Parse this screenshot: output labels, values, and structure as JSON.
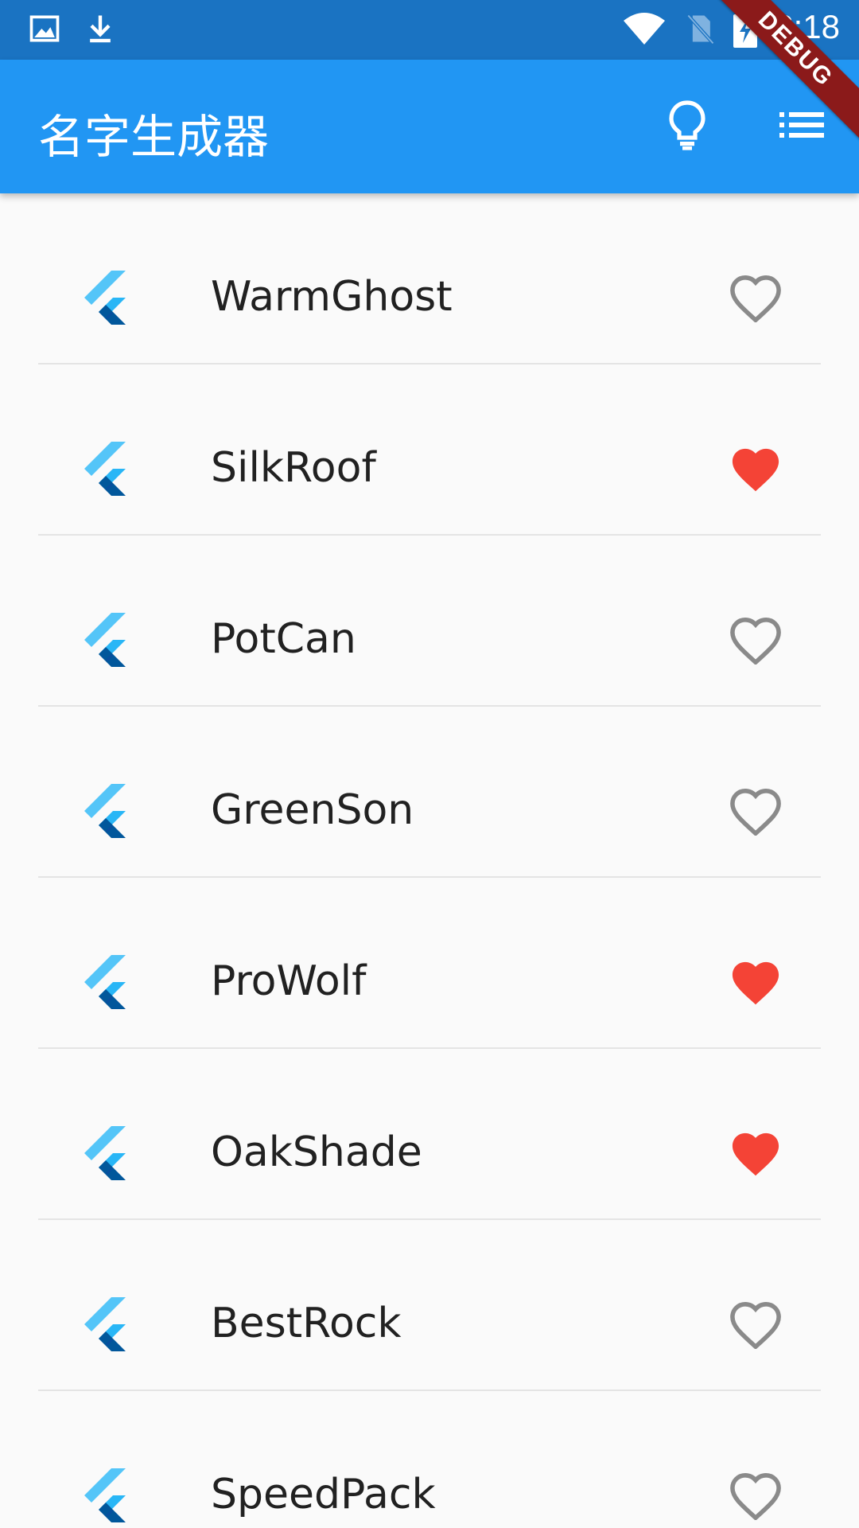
{
  "status_bar": {
    "time": "8:18",
    "icons": [
      "image-icon",
      "download-icon",
      "wifi-icon",
      "no-sim-icon",
      "battery-charging-icon"
    ],
    "color": "#1a73c2"
  },
  "debug_banner": "DEBUG",
  "app_bar": {
    "title": "名字生成器",
    "actions": [
      "lightbulb-icon",
      "list-icon"
    ],
    "color": "#2196f3"
  },
  "list": {
    "items": [
      {
        "name": "WarmGhost",
        "favorited": false
      },
      {
        "name": "SilkRoof",
        "favorited": true
      },
      {
        "name": "PotCan",
        "favorited": false
      },
      {
        "name": "GreenSon",
        "favorited": false
      },
      {
        "name": "ProWolf",
        "favorited": true
      },
      {
        "name": "OakShade",
        "favorited": true
      },
      {
        "name": "BestRock",
        "favorited": false
      },
      {
        "name": "SpeedPack",
        "favorited": false
      }
    ],
    "leading_icon": "flutter-logo-icon",
    "favorite_color": "#f44336",
    "unfavorite_color": "#8a8a8a"
  }
}
